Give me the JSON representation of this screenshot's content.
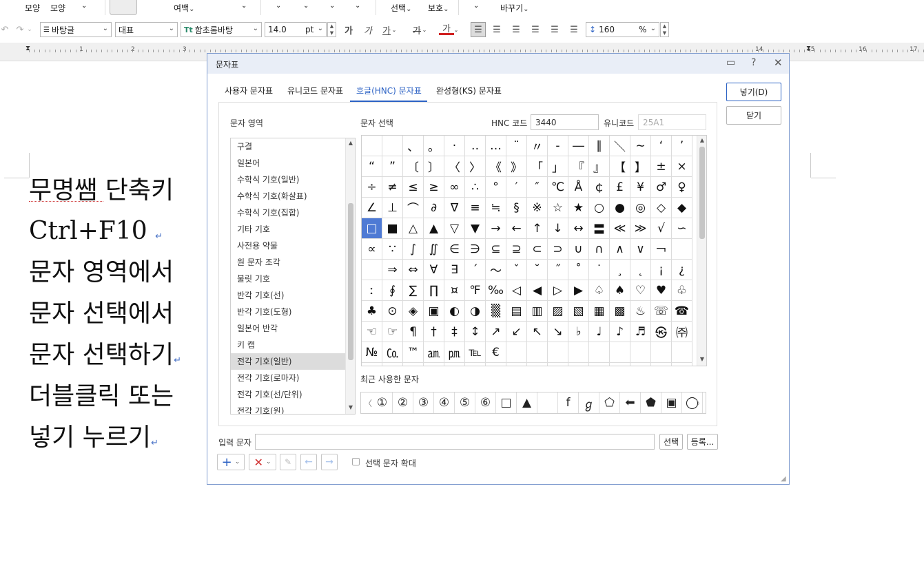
{
  "ribbon": {
    "items": [
      "모양",
      "모양",
      "여백",
      "선택",
      "보호",
      "바꾸기"
    ]
  },
  "toolbar": {
    "style_name": "바탕글",
    "lang": "대표",
    "font_name": "함초롬바탕",
    "font_size": "14.0",
    "font_unit": "pt",
    "bold": "가",
    "italic": "가",
    "underline": "가",
    "strike": "가",
    "font_color": "가",
    "line_spacing": "160",
    "line_spacing_unit": "%"
  },
  "ruler": {
    "numbers": [
      "1",
      "2",
      "3",
      "4",
      "5",
      "6",
      "7",
      "8",
      "9",
      "10",
      "11",
      "12",
      "13",
      "14",
      "15",
      "16",
      "17"
    ]
  },
  "document": {
    "lines": [
      "무명쌤 단축키",
      "Ctrl+F10",
      "문자 영역에서",
      "문자 선택에서",
      "문자 선택하기",
      "더블클릭 또는",
      "넣기 누르기"
    ],
    "paragraph_mark": "↵"
  },
  "dialog": {
    "title": "문자표",
    "tabs": [
      "사용자 문자표",
      "유니코드 문자표",
      "호글(HNC) 문자표",
      "완성형(KS) 문자표"
    ],
    "active_tab": 2,
    "insert_label": "넣기(D)",
    "close_label": "닫기",
    "area_label": "문자 영역",
    "select_label": "문자 선택",
    "hnc_code_label": "HNC 코드",
    "hnc_code_value": "3440",
    "unicode_label": "유니코드",
    "unicode_value": "25A1",
    "categories": [
      "구결",
      "일본어",
      "수학식 기호(일반)",
      "수학식 기호(화살표)",
      "수학식 기호(집합)",
      "기타 기호",
      "사전용 약물",
      "원 문자 조각",
      "불릿 기호",
      "반각 기호(선)",
      "반각 기호(도형)",
      "일본어 반각",
      "키 캡",
      "전각 기호(일반)",
      "전각 기호(로마자)",
      "전각 기호(선/단위)",
      "전각 기호(원)"
    ],
    "selected_category": 13,
    "grid": [
      " ",
      " ",
      "、",
      "。",
      "·",
      "‥",
      "…",
      "¨",
      "〃",
      "‐",
      "―",
      "∥",
      "＼",
      "∼",
      "‘",
      "’",
      "“",
      "”",
      "〔",
      "〕",
      "〈",
      "〉",
      "《",
      "》",
      "「",
      "」",
      "『",
      "』",
      "【",
      "】",
      "±",
      "×",
      "÷",
      "≠",
      "≤",
      "≥",
      "∞",
      "∴",
      "°",
      "′",
      "″",
      "℃",
      "Å",
      "￠",
      "£",
      "¥",
      "♂",
      "♀",
      "∠",
      "⊥",
      "⌒",
      "∂",
      "∇",
      "≡",
      "≒",
      "§",
      "※",
      "☆",
      "★",
      "○",
      "●",
      "◎",
      "◇",
      "◆",
      "□",
      "■",
      "△",
      "▲",
      "▽",
      "▼",
      "→",
      "←",
      "↑",
      "↓",
      "↔",
      "〓",
      "≪",
      "≫",
      "√",
      "∽",
      "∝",
      "∵",
      "∫",
      "∬",
      "∈",
      "∋",
      "⊆",
      "⊇",
      "⊂",
      "⊃",
      "∪",
      "∩",
      "∧",
      "∨",
      "￢",
      " ",
      " ",
      "⇒",
      "⇔",
      "∀",
      "∃",
      "´",
      "～",
      "ˇ",
      "˘",
      "˝",
      "˚",
      "˙",
      "¸",
      "˛",
      "¡",
      "¿",
      "ː",
      "∮",
      "∑",
      "∏",
      "¤",
      "℉",
      "‰",
      "◁",
      "◀",
      "▷",
      "▶",
      "♤",
      "♠",
      "♡",
      "♥",
      "♧",
      "♣",
      "⊙",
      "◈",
      "▣",
      "◐",
      "◑",
      "▒",
      "▤",
      "▥",
      "▨",
      "▧",
      "▦",
      "▩",
      "♨",
      "☏",
      "☎",
      "☜",
      "☞",
      "¶",
      "†",
      "‡",
      "↕",
      "↗",
      "↙",
      "↖",
      "↘",
      "♭",
      "♩",
      "♪",
      "♬",
      "㉿",
      "㈜",
      "№",
      "㏇",
      "™",
      "㏂",
      "㏘",
      "℡",
      "€",
      " ",
      " ",
      " ",
      " ",
      " ",
      " ",
      " ",
      " ",
      " ",
      " ",
      " ",
      " ",
      " ",
      " ",
      " ",
      " ",
      " ",
      " ",
      " ",
      " ",
      " ",
      " ",
      " ",
      " ",
      " "
    ],
    "selected_cell": 64,
    "recent_label": "최근 사용한 문자",
    "recent": [
      "①",
      "②",
      "③",
      "④",
      "⑤",
      "⑥",
      "□",
      "▲",
      " ",
      "f",
      "ℊ",
      "⬠",
      "⬅",
      "⬟",
      "▣",
      "◯"
    ],
    "input_label": "입력 문자",
    "input_value": "",
    "select_btn": "선택",
    "register_btn": "등록...",
    "enlarge_label": "선택 문자 확대"
  }
}
